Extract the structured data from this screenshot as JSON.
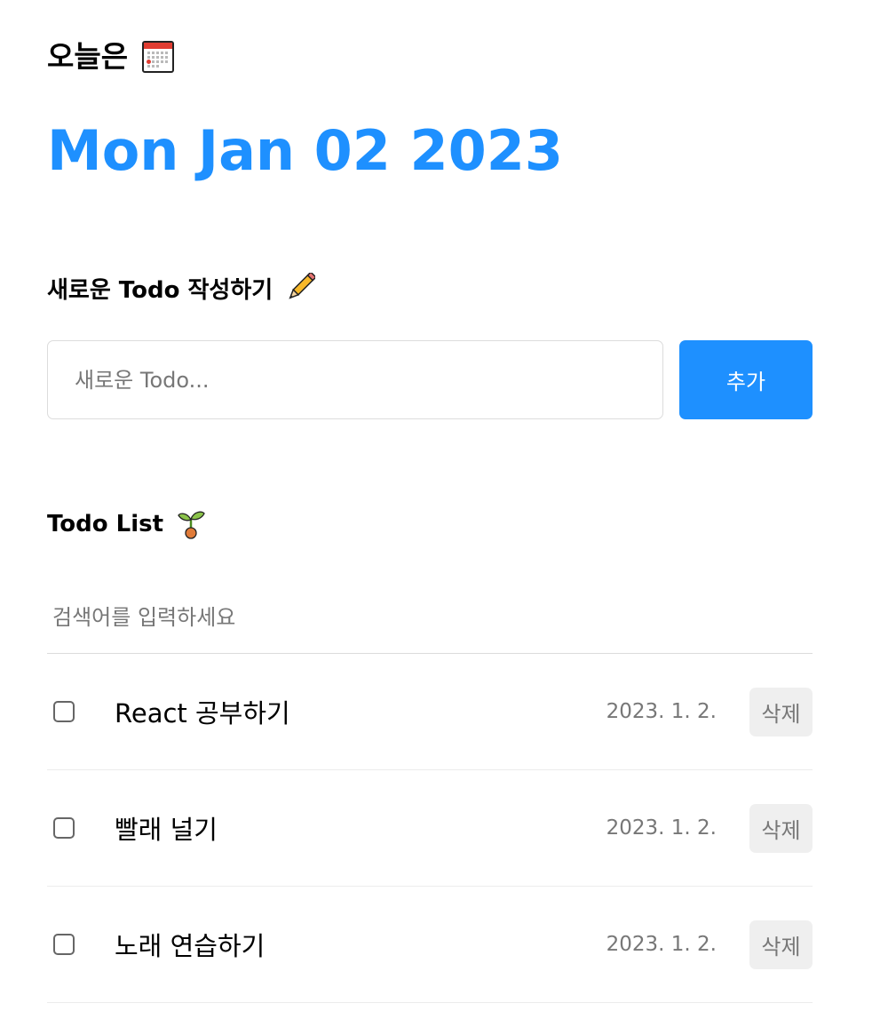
{
  "header": {
    "today_label": "오늘은",
    "today_icon": "calendar-icon",
    "date_text": "Mon Jan 02 2023",
    "accent_color": "#1e90ff"
  },
  "editor": {
    "title": "새로운 Todo 작성하기",
    "title_icon": "pencil-icon",
    "input_value": "",
    "input_placeholder": "새로운 Todo...",
    "add_label": "추가"
  },
  "list": {
    "title": "Todo List",
    "title_icon": "sprout-icon",
    "search_value": "",
    "search_placeholder": "검색어를 입력하세요",
    "items": [
      {
        "checked": false,
        "content": "React 공부하기",
        "date": "2023. 1. 2.",
        "delete_label": "삭제"
      },
      {
        "checked": false,
        "content": "빨래 널기",
        "date": "2023. 1. 2.",
        "delete_label": "삭제"
      },
      {
        "checked": false,
        "content": "노래 연습하기",
        "date": "2023. 1. 2.",
        "delete_label": "삭제"
      }
    ]
  }
}
